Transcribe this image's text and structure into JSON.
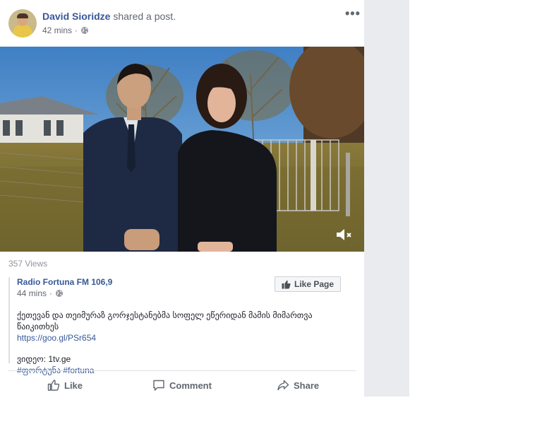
{
  "post": {
    "author": "David Sioridze",
    "action": "shared a post.",
    "time": "42 mins",
    "privacy_icon": "globe-icon",
    "more_label": "•••"
  },
  "video": {
    "audio_icon": "muted-speaker-icon"
  },
  "stats": {
    "views": "357 Views"
  },
  "shared": {
    "page_name": "Radio Fortuna FM 106,9",
    "time": "44 mins",
    "like_page_label": "Like Page",
    "text": "ქეთევან და თეიმურაზ გორჯესტანებმა სოფელ ეწერიდან მამის მიმართვა წაიკითხეს",
    "link": "https://goo.gl/PSr654",
    "source_line": "ვიდეო: 1tv.ge",
    "hashtags": "#ფორტუნა #fortuna"
  },
  "actions": {
    "like": "Like",
    "comment": "Comment",
    "share": "Share"
  },
  "colors": {
    "link_blue": "#365899",
    "page_gray": "#e9ebee",
    "text_gray": "#616770"
  }
}
